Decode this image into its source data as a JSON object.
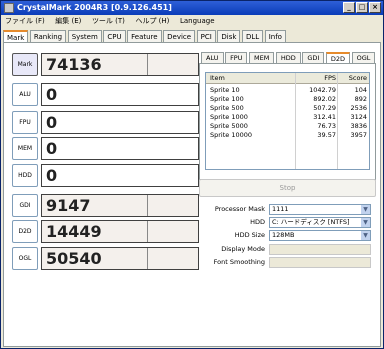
{
  "window": {
    "title": "CrystalMark 2004R3 [0.9.126.451]"
  },
  "menu": [
    "ファイル (F)",
    "編集 (E)",
    "ツール (T)",
    "ヘルプ (H)",
    "Language"
  ],
  "tabs": [
    "Mark",
    "Ranking",
    "System",
    "CPU",
    "Feature",
    "Device",
    "PCI",
    "Disk",
    "DLL",
    "Info"
  ],
  "active_tab": "Mark",
  "scores": [
    {
      "label": "Mark",
      "value": "74136"
    },
    {
      "label": "ALU",
      "value": "0"
    },
    {
      "label": "FPU",
      "value": "0"
    },
    {
      "label": "MEM",
      "value": "0"
    },
    {
      "label": "HDD",
      "value": "0"
    },
    {
      "label": "GDI",
      "value": "9147"
    },
    {
      "label": "D2D",
      "value": "14449"
    },
    {
      "label": "OGL",
      "value": "50540"
    }
  ],
  "right_tabs": [
    "ALU",
    "FPU",
    "MEM",
    "HDD",
    "GDI",
    "D2D",
    "OGL"
  ],
  "active_right_tab": "D2D",
  "list": {
    "headers": [
      "Item",
      "FPS",
      "Score"
    ],
    "rows": [
      [
        "Sprite    10",
        "1042.79",
        "104"
      ],
      [
        "Sprite   100",
        "892.02",
        "892"
      ],
      [
        "Sprite   500",
        "507.29",
        "2536"
      ],
      [
        "Sprite  1000",
        "312.41",
        "3124"
      ],
      [
        "Sprite  5000",
        "76.73",
        "3836"
      ],
      [
        "Sprite 10000",
        "39.57",
        "3957"
      ]
    ]
  },
  "stop_label": "Stop",
  "options": {
    "processor_mask_label": "Processor Mask",
    "processor_mask_value": "1111",
    "hdd_label": "HDD",
    "hdd_value": "C: ハードディスク [NTFS]",
    "hdd_size_label": "HDD Size",
    "hdd_size_value": "128MB",
    "display_mode_label": "Display Mode",
    "font_smoothing_label": "Font Smoothing"
  }
}
